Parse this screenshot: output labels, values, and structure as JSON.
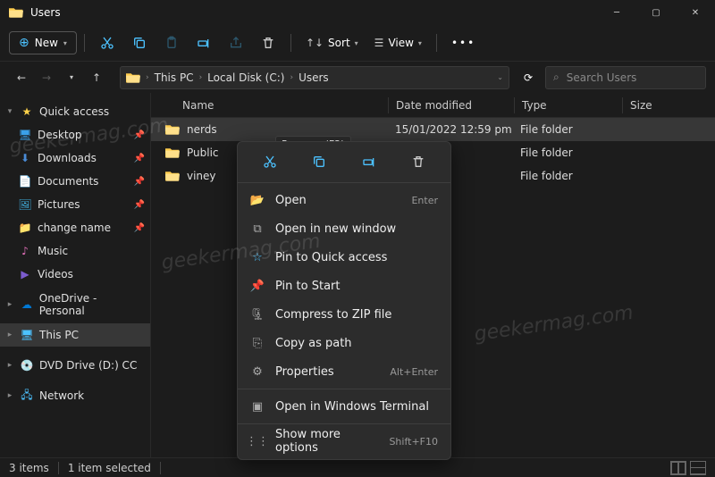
{
  "window": {
    "title": "Users"
  },
  "toolbar": {
    "new_label": "New",
    "sort_label": "Sort",
    "view_label": "View"
  },
  "nav": {
    "crumbs": [
      "This PC",
      "Local Disk (C:)",
      "Users"
    ],
    "search_placeholder": "Search Users"
  },
  "sidebar": {
    "quick_access": "Quick access",
    "items": [
      {
        "label": "Desktop"
      },
      {
        "label": "Downloads"
      },
      {
        "label": "Documents"
      },
      {
        "label": "Pictures"
      },
      {
        "label": "change name"
      },
      {
        "label": "Music"
      },
      {
        "label": "Videos"
      }
    ],
    "onedrive": "OneDrive - Personal",
    "thispc": "This PC",
    "dvd": "DVD Drive (D:) CCCC",
    "network": "Network"
  },
  "columns": {
    "name": "Name",
    "date": "Date modified",
    "type": "Type",
    "size": "Size"
  },
  "rows": [
    {
      "name": "nerds",
      "date": "15/01/2022 12:59 pm",
      "type": "File folder"
    },
    {
      "name": "Public",
      "date": "",
      "type": "File folder"
    },
    {
      "name": "viney",
      "date": "",
      "type": "File folder"
    }
  ],
  "tooltip": {
    "rename": "Rename (F2)"
  },
  "context_menu": {
    "open": "Open",
    "open_shortcut": "Enter",
    "open_new_window": "Open in new window",
    "pin_quick": "Pin to Quick access",
    "pin_start": "Pin to Start",
    "compress": "Compress to ZIP file",
    "copy_path": "Copy as path",
    "properties": "Properties",
    "properties_shortcut": "Alt+Enter",
    "open_terminal": "Open in Windows Terminal",
    "show_more": "Show more options",
    "show_more_shortcut": "Shift+F10"
  },
  "status": {
    "items": "3 items",
    "selected": "1 item selected"
  },
  "watermark": "geekermag.com"
}
